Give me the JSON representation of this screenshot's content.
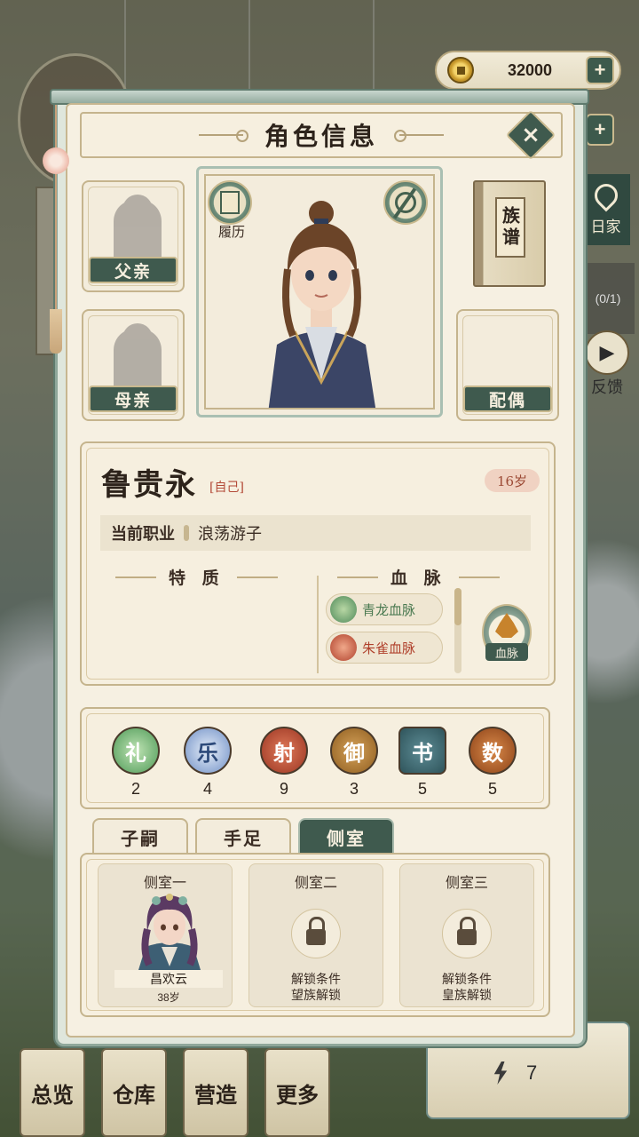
{
  "hud": {
    "coins": "32000",
    "plus": "+",
    "side_home_label": "日家",
    "task_progress": "(0/1)",
    "feedback_label": "反馈",
    "energy_value": "7"
  },
  "bottom_menu": [
    "总览",
    "仓库",
    "营造",
    "更多"
  ],
  "panel": {
    "title": "角色信息",
    "close": "×",
    "father_label": "父亲",
    "mother_label": "母亲",
    "spouse_label": "配偶",
    "resume_label": "履历",
    "genealogy_label": "族谱"
  },
  "character": {
    "name": "鲁贵永",
    "self_tag": "[自己]",
    "age": "16岁",
    "job_label": "当前职业",
    "job_value": "浪荡游子",
    "traits_header": "特 质",
    "bloodline_header": "血 脉",
    "bloodlines": [
      "青龙血脉",
      "朱雀血脉"
    ],
    "bloodline_button": "血脉"
  },
  "arts": [
    {
      "label": "礼",
      "value": "2",
      "color": "#5aa35f"
    },
    {
      "label": "乐",
      "value": "4",
      "color": "#6f8fc6"
    },
    {
      "label": "射",
      "value": "9",
      "color": "#b2452f"
    },
    {
      "label": "御",
      "value": "3",
      "color": "#a8742b"
    },
    {
      "label": "书",
      "value": "5",
      "color": "#3f6b73"
    },
    {
      "label": "数",
      "value": "5",
      "color": "#a8552b"
    }
  ],
  "tabs": [
    "子嗣",
    "手足",
    "侧室"
  ],
  "concubines": {
    "slot1": {
      "title": "侧室一",
      "name": "昌欢云",
      "age": "38岁"
    },
    "slot2": {
      "title": "侧室二",
      "unlock_line1": "解锁条件",
      "unlock_line2": "望族解锁"
    },
    "slot3": {
      "title": "侧室三",
      "unlock_line1": "解锁条件",
      "unlock_line2": "皇族解锁"
    }
  }
}
